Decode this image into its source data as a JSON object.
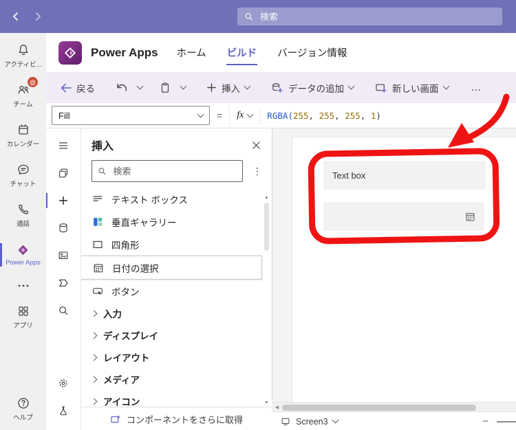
{
  "colors": {
    "teams_purple": "#6e71b8",
    "powerapps_brand": "#742774",
    "accent_purple": "#5b5fc7",
    "annotation_red": "#ee1414"
  },
  "titlebar": {
    "search_placeholder": "検索"
  },
  "rail": {
    "items": [
      {
        "label": "アクティビ...",
        "icon": "bell"
      },
      {
        "label": "チーム",
        "icon": "teams-people",
        "badge": "@"
      },
      {
        "label": "カレンダー",
        "icon": "calendar"
      },
      {
        "label": "チャット",
        "icon": "chat"
      },
      {
        "label": "通話",
        "icon": "phone"
      },
      {
        "label": "Power Apps",
        "icon": "power-apps",
        "active": true
      },
      {
        "label": "",
        "icon": "more-horizontal"
      },
      {
        "label": "アプリ",
        "icon": "apps-grid"
      },
      {
        "label": "ヘルプ",
        "icon": "help"
      }
    ]
  },
  "header": {
    "app_title": "Power Apps",
    "tabs": [
      {
        "label": "ホーム",
        "active": false
      },
      {
        "label": "ビルド",
        "active": true
      },
      {
        "label": "バージョン情報",
        "active": false
      }
    ]
  },
  "toolbar": {
    "back_label": "戻る",
    "insert_label": "挿入",
    "add_data_label": "データの追加",
    "new_screen_label": "新しい画面",
    "overflow_label": "…"
  },
  "formula_bar": {
    "property_selected": "Fill",
    "equals": "=",
    "fx_label": "fx",
    "formula_text": "RGBA(255, 255, 255, 1)",
    "tokens": [
      {
        "text": "RGBA(",
        "type": "function"
      },
      {
        "text": "255",
        "type": "number"
      },
      {
        "text": ", ",
        "type": "punct"
      },
      {
        "text": "255",
        "type": "number"
      },
      {
        "text": ", ",
        "type": "punct"
      },
      {
        "text": "255",
        "type": "number"
      },
      {
        "text": ", ",
        "type": "punct"
      },
      {
        "text": "1",
        "type": "number"
      },
      {
        "text": ")",
        "type": "punct"
      }
    ]
  },
  "insert_panel": {
    "title": "挿入",
    "search_placeholder": "検索",
    "controls": [
      {
        "label": "テキスト ボックス",
        "icon": "text-box"
      },
      {
        "label": "垂直ギャラリー",
        "icon": "vertical-gallery"
      },
      {
        "label": "四角形",
        "icon": "rectangle"
      },
      {
        "label": "日付の選択",
        "icon": "date-picker",
        "highlighted": true
      },
      {
        "label": "ボタン",
        "icon": "button"
      }
    ],
    "categories": [
      {
        "label": "入力"
      },
      {
        "label": "ディスプレイ"
      },
      {
        "label": "レイアウト"
      },
      {
        "label": "メディア"
      },
      {
        "label": "アイコン"
      }
    ],
    "footer_label": "コンポーネントをさらに取得"
  },
  "canvas": {
    "textbox_label": "Text box"
  },
  "statusbar": {
    "screen_name": "Screen3",
    "zoom_out": "−"
  },
  "icons": {
    "more_vertical": "⋮",
    "scroll_up": "▲",
    "scroll_down": "▼",
    "scroll_left": "◀"
  }
}
